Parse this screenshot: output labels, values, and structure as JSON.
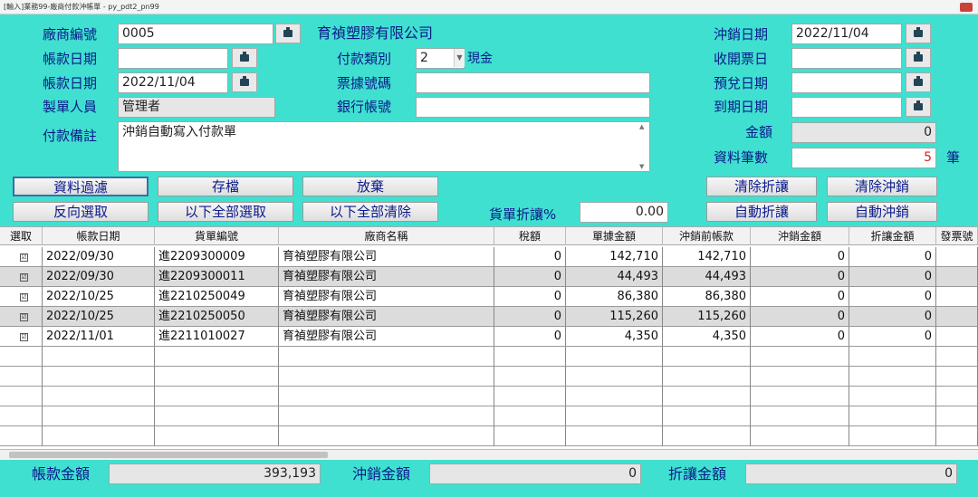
{
  "window": {
    "title": "[輸入]業務99-廠商付款沖帳單 - py_pdt2_pn99"
  },
  "form": {
    "vendor_code_label": "廠商編號",
    "vendor_code": "0005",
    "vendor_name": "育禎塑膠有限公司",
    "account_date1_label": "帳款日期",
    "account_date1": "",
    "account_date2_label": "帳款日期",
    "account_date2": "2022/11/04",
    "creator_label": "製單人員",
    "creator": "管理者",
    "note_label": "付款備註",
    "note": "沖銷自動寫入付款單",
    "pay_type_label": "付款類別",
    "pay_type_value": "2",
    "pay_type_text": "現金",
    "voucher_no_label": "票據號碼",
    "voucher_no": "",
    "bank_account_label": "銀行帳號",
    "bank_account": "",
    "writeoff_date_label": "沖銷日期",
    "writeoff_date": "2022/11/04",
    "issue_date_label": "收開票日",
    "issue_date": "",
    "expected_date_label": "預兌日期",
    "expected_date": "",
    "due_date_label": "到期日期",
    "due_date": "",
    "amount_label": "金額",
    "amount": "0",
    "record_count_label": "資料筆數",
    "record_count": "5",
    "record_unit": "筆"
  },
  "buttons": {
    "filter": "資料過濾",
    "save": "存檔",
    "abandon": "放棄",
    "clear_discount": "清除折讓",
    "clear_writeoff": "清除沖銷",
    "reverse_select": "反向選取",
    "select_all_below": "以下全部選取",
    "clear_all_below": "以下全部清除",
    "auto_discount": "自動折讓",
    "auto_writeoff": "自動沖銷"
  },
  "discount": {
    "label": "貨單折讓%",
    "value": "0.00"
  },
  "table": {
    "headers": [
      "選取",
      "帳款日期",
      "貨單編號",
      "廠商名稱",
      "稅額",
      "單據金額",
      "沖銷前帳款",
      "沖銷金額",
      "折讓金額",
      "發票號"
    ],
    "rows": [
      {
        "date": "2022/09/30",
        "no": "進2209300009",
        "vendor": "育禎塑膠有限公司",
        "tax": "0",
        "amount": "142,710",
        "before": "142,710",
        "writeoff": "0",
        "discount": "0"
      },
      {
        "date": "2022/09/30",
        "no": "進2209300011",
        "vendor": "育禎塑膠有限公司",
        "tax": "0",
        "amount": "44,493",
        "before": "44,493",
        "writeoff": "0",
        "discount": "0"
      },
      {
        "date": "2022/10/25",
        "no": "進2210250049",
        "vendor": "育禎塑膠有限公司",
        "tax": "0",
        "amount": "86,380",
        "before": "86,380",
        "writeoff": "0",
        "discount": "0"
      },
      {
        "date": "2022/10/25",
        "no": "進2210250050",
        "vendor": "育禎塑膠有限公司",
        "tax": "0",
        "amount": "115,260",
        "before": "115,260",
        "writeoff": "0",
        "discount": "0"
      },
      {
        "date": "2022/11/01",
        "no": "進2211010027",
        "vendor": "育禎塑膠有限公司",
        "tax": "0",
        "amount": "4,350",
        "before": "4,350",
        "writeoff": "0",
        "discount": "0"
      }
    ]
  },
  "footer": {
    "account_total_label": "帳款金額",
    "account_total": "393,193",
    "writeoff_total_label": "沖銷金額",
    "writeoff_total": "0",
    "discount_total_label": "折讓金額",
    "discount_total": "0"
  },
  "colors": {
    "background": "#40e0d0",
    "label": "#0a1a8a",
    "count_red": "#e02020"
  }
}
